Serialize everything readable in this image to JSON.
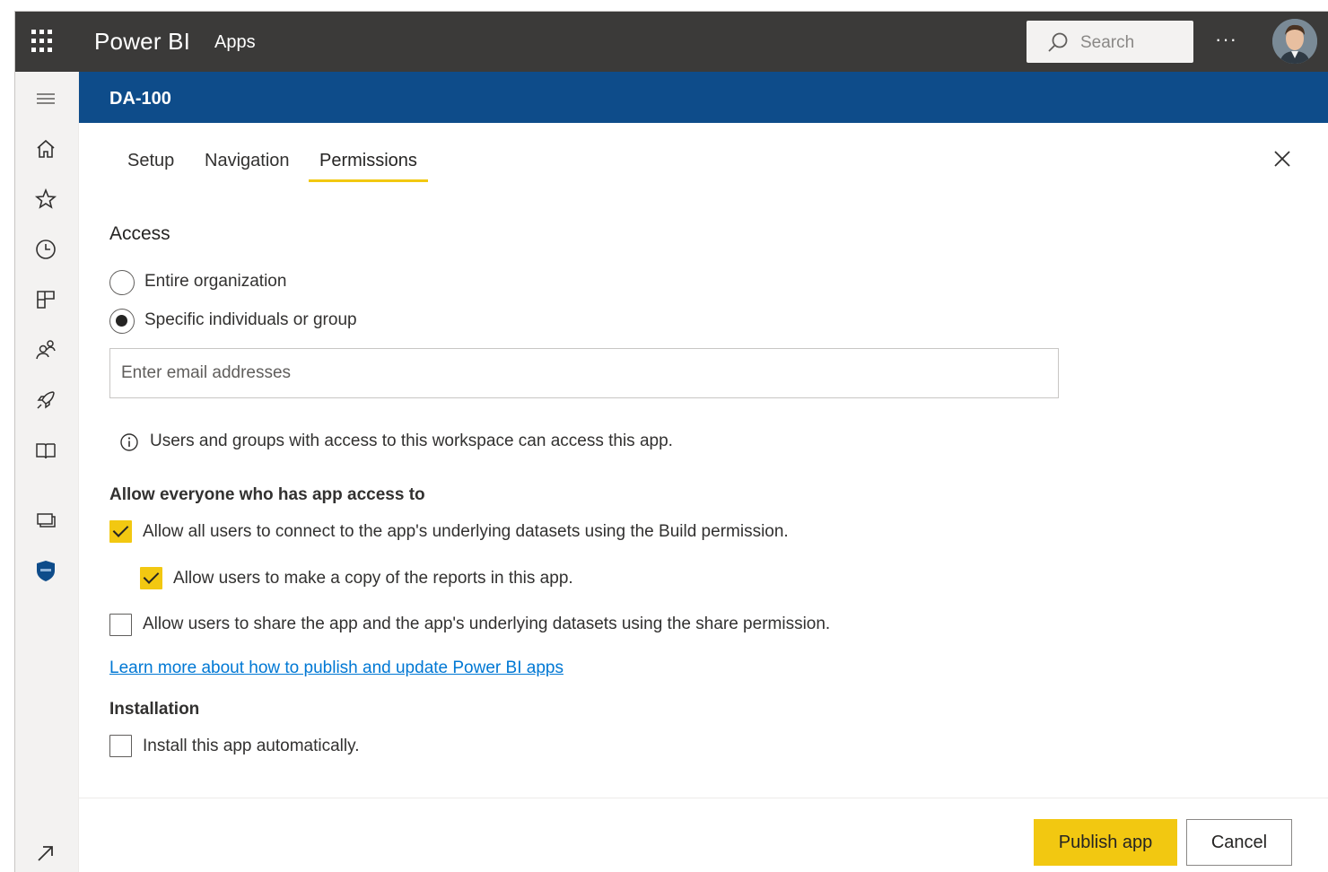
{
  "topbar": {
    "app_name": "Power BI",
    "breadcrumb": "Apps",
    "search_placeholder": "Search",
    "more_label": "···"
  },
  "leftnav": {
    "icons": [
      "hamburger-icon",
      "home-icon",
      "star-icon",
      "clock-icon",
      "apps-icon",
      "people-icon",
      "rocket-icon",
      "book-icon",
      "workspaces-icon",
      "workspace-shield-icon",
      "expand-icon"
    ]
  },
  "app_header": {
    "title": "DA-100"
  },
  "tabs": [
    {
      "label": "Setup",
      "active": false
    },
    {
      "label": "Navigation",
      "active": false
    },
    {
      "label": "Permissions",
      "active": true
    }
  ],
  "access": {
    "title": "Access",
    "options": [
      {
        "label": "Entire organization",
        "selected": false
      },
      {
        "label": "Specific individuals or group",
        "selected": true
      }
    ],
    "email_placeholder": "Enter email addresses",
    "info_text": "Users and groups with access to this workspace can access this app."
  },
  "allow": {
    "title": "Allow everyone who has app access to",
    "options": [
      {
        "label": "Allow all users to connect to the app's underlying datasets using the Build permission.",
        "checked": true
      },
      {
        "label": "Allow users to make a copy of the reports in this app.",
        "checked": true
      },
      {
        "label": "Allow users to share the app and the app's underlying datasets using the share permission.",
        "checked": false
      }
    ],
    "learn_more": "Learn more about how to publish and update Power BI apps"
  },
  "installation": {
    "title": "Installation",
    "option": {
      "label": "Install this app automatically.",
      "checked": false
    }
  },
  "footer": {
    "publish_label": "Publish app",
    "cancel_label": "Cancel"
  },
  "colors": {
    "topbar": "#3b3a39",
    "app_header": "#0e4c8a",
    "accent": "#f2c811",
    "link": "#0078d4"
  }
}
